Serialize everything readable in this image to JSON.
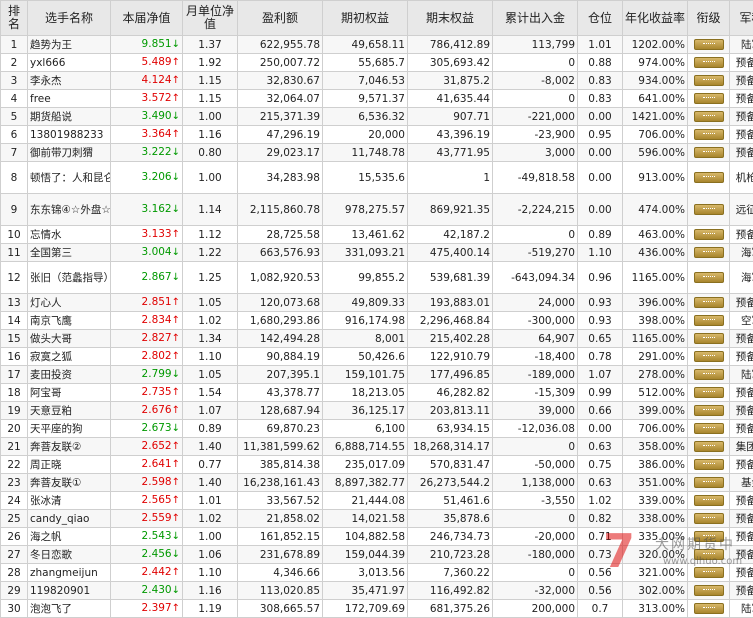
{
  "headers": {
    "rank": "排名",
    "name": "选手名称",
    "nav": "本届净值",
    "monthly_nav": "月单位净值",
    "profit": "盈利额",
    "start_equity": "期初权益",
    "end_equity": "期末权益",
    "cumulative_flow": "累计出入金",
    "position": "仓位",
    "annual_return": "年化收益率",
    "rank_badge": "衔级",
    "army": "军种"
  },
  "colors": {
    "up": "#e00000",
    "down": "#009900",
    "header_bg": "#e8e8e8"
  },
  "watermark": {
    "text": "期货中",
    "mark": "7",
    "url": "www.qihuo.com",
    "partial_text": "大网"
  },
  "rows": [
    {
      "rank": "1",
      "name": "趋势为王",
      "nav": "9.851",
      "dir": "down",
      "monthly": "1.37",
      "profit": "622,955.78",
      "start": "49,658.11",
      "end": "786,412.89",
      "flow": "113,799",
      "pos": "1.01",
      "annual": "1202.00%",
      "badge": "rank-badge-icon",
      "army": "陆军"
    },
    {
      "rank": "2",
      "name": "yxl666",
      "nav": "5.489",
      "dir": "up",
      "monthly": "1.92",
      "profit": "250,007.72",
      "start": "55,685.7",
      "end": "305,693.42",
      "flow": "0",
      "pos": "0.88",
      "annual": "974.00%",
      "badge": "rank-badge-icon",
      "army": "预备役"
    },
    {
      "rank": "3",
      "name": "李永杰",
      "nav": "4.124",
      "dir": "up",
      "monthly": "1.15",
      "profit": "32,830.67",
      "start": "7,046.53",
      "end": "31,875.2",
      "flow": "-8,002",
      "pos": "0.83",
      "annual": "934.00%",
      "badge": "rank-badge-icon",
      "army": "预备役"
    },
    {
      "rank": "4",
      "name": "free",
      "nav": "3.572",
      "dir": "up",
      "monthly": "1.15",
      "profit": "32,064.07",
      "start": "9,571.37",
      "end": "41,635.44",
      "flow": "0",
      "pos": "0.83",
      "annual": "641.00%",
      "badge": "rank-badge-icon",
      "army": "预备役"
    },
    {
      "rank": "5",
      "name": "期货船说",
      "nav": "3.490",
      "dir": "down",
      "monthly": "1.00",
      "profit": "215,371.39",
      "start": "6,536.32",
      "end": "907.71",
      "flow": "-221,000",
      "pos": "0.00",
      "annual": "1421.00%",
      "badge": "rank-badge-icon",
      "army": "预备役"
    },
    {
      "rank": "6",
      "name": "13801988233",
      "nav": "3.364",
      "dir": "up",
      "monthly": "1.16",
      "profit": "47,296.19",
      "start": "20,000",
      "end": "43,396.19",
      "flow": "-23,900",
      "pos": "0.95",
      "annual": "706.00%",
      "badge": "rank-badge-icon",
      "army": "预备役"
    },
    {
      "rank": "7",
      "name": "御前带刀刺猬",
      "nav": "3.222",
      "dir": "down",
      "monthly": "0.80",
      "profit": "29,023.17",
      "start": "11,748.78",
      "end": "43,771.95",
      "flow": "3,000",
      "pos": "0.00",
      "annual": "596.00%",
      "badge": "rank-badge-icon",
      "army": "预备役"
    },
    {
      "rank": "8",
      "name": "顿悟了：人和昆仑基金",
      "nav": "3.206",
      "dir": "down",
      "monthly": "1.00",
      "profit": "34,283.98",
      "start": "15,535.6",
      "end": "1",
      "flow": "-49,818.58",
      "pos": "0.00",
      "annual": "913.00%",
      "badge": "rank-badge-icon",
      "army": "机枪手",
      "tall": true
    },
    {
      "rank": "9",
      "name": "东东锦④☆外盘☆",
      "nav": "3.162",
      "dir": "down",
      "monthly": "1.14",
      "profit": "2,115,860.78",
      "start": "978,275.57",
      "end": "869,921.35",
      "flow": "-2,224,215",
      "pos": "0.00",
      "annual": "474.00%",
      "badge": "rank-badge-icon",
      "army": "远征军",
      "tall": true
    },
    {
      "rank": "10",
      "name": "忘情水",
      "nav": "3.133",
      "dir": "up",
      "monthly": "1.12",
      "profit": "28,725.58",
      "start": "13,461.62",
      "end": "42,187.2",
      "flow": "0",
      "pos": "0.89",
      "annual": "463.00%",
      "badge": "rank-badge-icon",
      "army": "预备役"
    },
    {
      "rank": "11",
      "name": "全国第三",
      "nav": "3.004",
      "dir": "down",
      "monthly": "1.22",
      "profit": "663,576.93",
      "start": "331,093.21",
      "end": "475,400.14",
      "flow": "-519,270",
      "pos": "1.10",
      "annual": "436.00%",
      "badge": "rank-badge-icon",
      "army": "海军"
    },
    {
      "rank": "12",
      "name": "张旧（范蠡指导）",
      "nav": "2.867",
      "dir": "down",
      "monthly": "1.25",
      "profit": "1,082,920.53",
      "start": "99,855.2",
      "end": "539,681.39",
      "flow": "-643,094.34",
      "pos": "0.96",
      "annual": "1165.00%",
      "badge": "rank-badge-icon",
      "army": "海军",
      "tall": true
    },
    {
      "rank": "13",
      "name": "灯心人",
      "nav": "2.851",
      "dir": "up",
      "monthly": "1.05",
      "profit": "120,073.68",
      "start": "49,809.33",
      "end": "193,883.01",
      "flow": "24,000",
      "pos": "0.93",
      "annual": "396.00%",
      "badge": "rank-badge-icon",
      "army": "预备役"
    },
    {
      "rank": "14",
      "name": "南京飞鹰",
      "nav": "2.834",
      "dir": "up",
      "monthly": "1.02",
      "profit": "1,680,293.86",
      "start": "916,174.98",
      "end": "2,296,468.84",
      "flow": "-300,000",
      "pos": "0.93",
      "annual": "398.00%",
      "badge": "rank-badge-icon",
      "army": "空军"
    },
    {
      "rank": "15",
      "name": "做头大哥",
      "nav": "2.827",
      "dir": "up",
      "monthly": "1.34",
      "profit": "142,494.28",
      "start": "8,001",
      "end": "215,402.28",
      "flow": "64,907",
      "pos": "0.65",
      "annual": "1165.00%",
      "badge": "rank-badge-icon",
      "army": "预备役"
    },
    {
      "rank": "16",
      "name": "寂寞之狐",
      "nav": "2.802",
      "dir": "up",
      "monthly": "1.10",
      "profit": "90,884.19",
      "start": "50,426.6",
      "end": "122,910.79",
      "flow": "-18,400",
      "pos": "0.78",
      "annual": "291.00%",
      "badge": "rank-badge-icon",
      "army": "预备役"
    },
    {
      "rank": "17",
      "name": "麦田投资",
      "nav": "2.799",
      "dir": "down",
      "monthly": "1.05",
      "profit": "207,395.1",
      "start": "159,101.75",
      "end": "177,496.85",
      "flow": "-189,000",
      "pos": "1.07",
      "annual": "278.00%",
      "badge": "rank-badge-icon",
      "army": "陆军"
    },
    {
      "rank": "18",
      "name": "阿宝哥",
      "nav": "2.735",
      "dir": "up",
      "monthly": "1.54",
      "profit": "43,378.77",
      "start": "18,213.05",
      "end": "46,282.82",
      "flow": "-15,309",
      "pos": "0.99",
      "annual": "512.00%",
      "badge": "rank-badge-icon",
      "army": "预备役"
    },
    {
      "rank": "19",
      "name": "天意豆粕",
      "nav": "2.676",
      "dir": "up",
      "monthly": "1.07",
      "profit": "128,687.94",
      "start": "36,125.17",
      "end": "203,813.11",
      "flow": "39,000",
      "pos": "0.66",
      "annual": "399.00%",
      "badge": "rank-badge-icon",
      "army": "预备役"
    },
    {
      "rank": "20",
      "name": "天平座的狗",
      "nav": "2.673",
      "dir": "down",
      "monthly": "0.89",
      "profit": "69,870.23",
      "start": "6,100",
      "end": "63,934.15",
      "flow": "-12,036.08",
      "pos": "0.00",
      "annual": "706.00%",
      "badge": "rank-badge-icon",
      "army": "预备役"
    },
    {
      "rank": "21",
      "name": "奔菩友联②",
      "nav": "2.652",
      "dir": "up",
      "monthly": "1.40",
      "profit": "11,381,599.62",
      "start": "6,888,714.55",
      "end": "18,268,314.17",
      "flow": "0",
      "pos": "0.63",
      "annual": "358.00%",
      "badge": "rank-badge-icon",
      "army": "集团军"
    },
    {
      "rank": "22",
      "name": "周正晓",
      "nav": "2.641",
      "dir": "up",
      "monthly": "0.77",
      "profit": "385,814.38",
      "start": "235,017.09",
      "end": "570,831.47",
      "flow": "-50,000",
      "pos": "0.75",
      "annual": "386.00%",
      "badge": "rank-badge-icon",
      "army": "预备役"
    },
    {
      "rank": "23",
      "name": "奔菩友联①",
      "nav": "2.598",
      "dir": "up",
      "monthly": "1.40",
      "profit": "16,238,161.43",
      "start": "8,897,382.77",
      "end": "26,273,544.2",
      "flow": "1,138,000",
      "pos": "0.63",
      "annual": "351.00%",
      "badge": "rank-badge-icon",
      "army": "基金"
    },
    {
      "rank": "24",
      "name": "张冰清",
      "nav": "2.565",
      "dir": "up",
      "monthly": "1.01",
      "profit": "33,567.52",
      "start": "21,444.08",
      "end": "51,461.6",
      "flow": "-3,550",
      "pos": "1.02",
      "annual": "339.00%",
      "badge": "rank-badge-icon",
      "army": "预备役"
    },
    {
      "rank": "25",
      "name": "candy_qiao",
      "nav": "2.559",
      "dir": "up",
      "monthly": "1.02",
      "profit": "21,858.02",
      "start": "14,021.58",
      "end": "35,878.6",
      "flow": "0",
      "pos": "0.82",
      "annual": "338.00%",
      "badge": "rank-badge-icon",
      "army": "预备役"
    },
    {
      "rank": "26",
      "name": "海之帆",
      "nav": "2.543",
      "dir": "down",
      "monthly": "1.00",
      "profit": "161,852.15",
      "start": "104,882.58",
      "end": "246,734.73",
      "flow": "-20,000",
      "pos": "0.71",
      "annual": "335.00%",
      "badge": "rank-badge-icon",
      "army": "预备役"
    },
    {
      "rank": "27",
      "name": "冬日恋歌",
      "nav": "2.456",
      "dir": "down",
      "monthly": "1.06",
      "profit": "231,678.89",
      "start": "159,044.39",
      "end": "210,723.28",
      "flow": "-180,000",
      "pos": "0.73",
      "annual": "320.00%",
      "badge": "rank-badge-icon",
      "army": "预备役"
    },
    {
      "rank": "28",
      "name": "zhangmeijun",
      "nav": "2.442",
      "dir": "up",
      "monthly": "1.10",
      "profit": "4,346.66",
      "start": "3,013.56",
      "end": "7,360.22",
      "flow": "0",
      "pos": "0.56",
      "annual": "321.00%",
      "badge": "rank-badge-icon",
      "army": "预备役"
    },
    {
      "rank": "29",
      "name": "119820901",
      "nav": "2.430",
      "dir": "down",
      "monthly": "1.16",
      "profit": "113,020.85",
      "start": "35,471.97",
      "end": "116,492.82",
      "flow": "-32,000",
      "pos": "0.56",
      "annual": "302.00%",
      "badge": "rank-badge-icon",
      "army": "预备役"
    },
    {
      "rank": "30",
      "name": "泡泡飞了",
      "nav": "2.397",
      "dir": "up",
      "monthly": "1.19",
      "profit": "308,665.57",
      "start": "172,709.69",
      "end": "681,375.26",
      "flow": "200,000",
      "pos": "0.7",
      "annual": "313.00%",
      "badge": "rank-badge-icon",
      "army": "陆军"
    }
  ]
}
